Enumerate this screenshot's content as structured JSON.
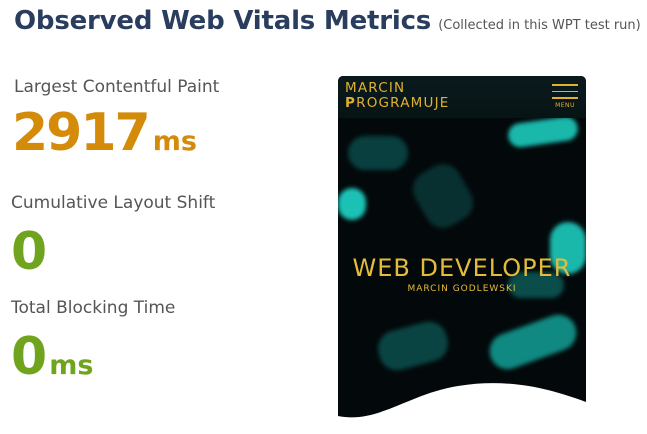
{
  "header": {
    "title": "Observed Web Vitals Metrics",
    "subtitle": "(Collected in this WPT test run)"
  },
  "metrics": [
    {
      "label": "Largest Contentful Paint",
      "value": "2917",
      "unit": "ms",
      "color": "#d48b0a"
    },
    {
      "label": "Cumulative Layout Shift",
      "value": "0",
      "unit": "",
      "color": "#71a41e"
    },
    {
      "label": "Total Blocking Time",
      "value": "0",
      "unit": "ms",
      "color": "#71a41e"
    }
  ],
  "screenshot": {
    "logo_line1": "MARCIN",
    "logo_line2_first": "P",
    "logo_line2_rest": "ROGRAMUJE",
    "menu_label": "MENU",
    "hero_title": "WEB DEVELOPER",
    "hero_subtitle": "MARCIN GODLEWSKI",
    "accent": "#e0b130",
    "glow": "#1fd6c8"
  }
}
